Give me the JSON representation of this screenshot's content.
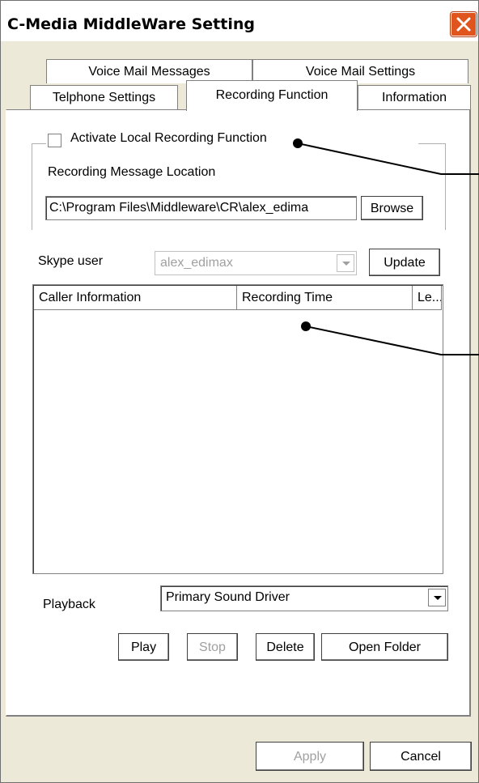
{
  "window": {
    "title": "C-Media MiddleWare Setting"
  },
  "tabs": {
    "row1": [
      "Voice Mail Messages",
      "Voice Mail Settings"
    ],
    "row2": [
      "Telphone Settings",
      "Recording Function",
      "Information"
    ],
    "active": "Recording Function"
  },
  "recording": {
    "activate_label": "Activate Local Recording Function",
    "activate_checked": false,
    "location_label": "Recording Message Location",
    "location_value": "C:\\Program Files\\Middleware\\CR\\alex_edima",
    "browse_label": "Browse"
  },
  "skype": {
    "label": "Skype user",
    "value": "alex_edimax",
    "update_label": "Update"
  },
  "list": {
    "columns": [
      "Caller Information",
      "Recording Time",
      "Le..."
    ],
    "rows": []
  },
  "playback": {
    "label": "Playback",
    "value": "Primary Sound Driver"
  },
  "buttons": {
    "play": "Play",
    "stop": "Stop",
    "delete": "Delete",
    "open_folder": "Open Folder",
    "apply": "Apply",
    "cancel": "Cancel"
  },
  "icons": {
    "close": "close-icon",
    "dropdown": "chevron-down-icon"
  },
  "colors": {
    "close_button": "#e0541e",
    "disabled_text": "#a0a0a0"
  }
}
